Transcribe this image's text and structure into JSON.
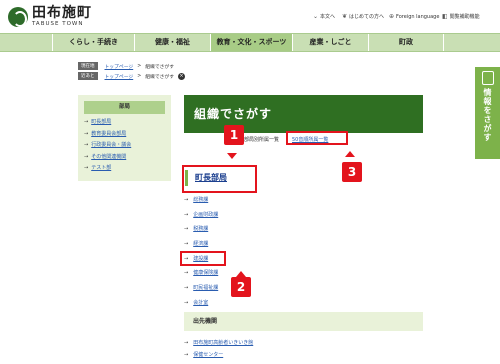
{
  "header": {
    "logo_title": "田布施町",
    "logo_sub": "TABUSE TOWN",
    "utils": [
      {
        "icon": "arrow-down-icon",
        "label": "本文へ"
      },
      {
        "icon": "leaf-icon",
        "label": "はじめての方へ"
      },
      {
        "icon": "globe-icon",
        "label": "Foreign language"
      },
      {
        "icon": "speaker-icon",
        "label": "閲覧補助機能"
      }
    ]
  },
  "nav": {
    "items": [
      "くらし・手続き",
      "健康・福祉",
      "教育・文化・スポーツ",
      "産業・しごと",
      "町政"
    ],
    "active_index": 2
  },
  "breadcrumbs": {
    "current_label": "現在地",
    "trail1": [
      "トップページ",
      "組織でさがす"
    ],
    "recent_label": "近あと",
    "trail2": [
      "トップページ",
      "組織でさがす"
    ],
    "close": "×"
  },
  "side_tab": {
    "label": "情報をさがす"
  },
  "sidebar": {
    "heading": "部局",
    "items": [
      "町長部局",
      "教育委員会部局",
      "行政委員会・議会",
      "その他関連機関",
      "テスト部"
    ]
  },
  "main": {
    "banner_title": "組織でさがす",
    "category_text": "部局別所属一覧",
    "category_link": "50音順所属一覧",
    "section_title": "町長部局",
    "departments": [
      "総務課",
      "企画財政課",
      "税務課",
      "経済課",
      "建設課",
      "健康保険課",
      "町民福祉課",
      "会計室"
    ],
    "branch_heading": "出先機関",
    "branch_items": [
      "田布施町高齢者いきいき館",
      "保健センター"
    ]
  },
  "annotations": {
    "badge1": "1",
    "badge2": "2",
    "badge3": "3",
    "color": "#e3141d"
  }
}
